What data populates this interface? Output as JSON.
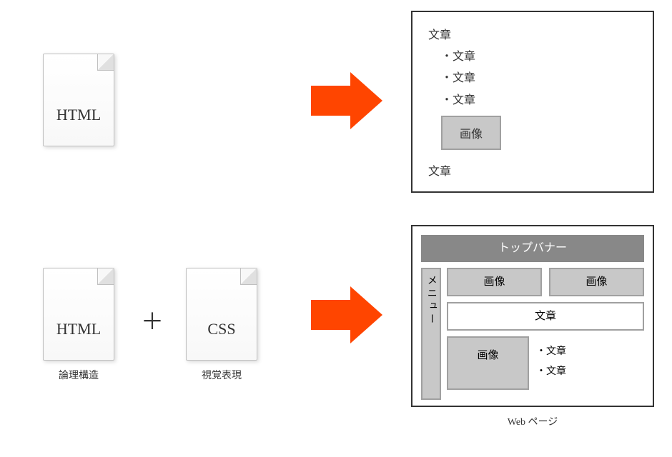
{
  "row1": {
    "html_file_label": "HTML",
    "arrow": "arrow-right",
    "output": {
      "text_top": "文章",
      "bullets": [
        "・文章",
        "・文章",
        "・文章"
      ],
      "image_label": "画像",
      "text_bottom": "文章"
    }
  },
  "row2": {
    "html_file_label": "HTML",
    "html_caption": "論理構造",
    "plus": "＋",
    "css_file_label": "CSS",
    "css_caption": "視覚表現",
    "arrow": "arrow-right",
    "output": {
      "top_banner": "トップバナー",
      "sidebar_label": "メニュー",
      "image_label": "画像",
      "text_label": "文章",
      "bullets": [
        "・文章",
        "・文章"
      ]
    },
    "page_caption": "Web ページ"
  }
}
